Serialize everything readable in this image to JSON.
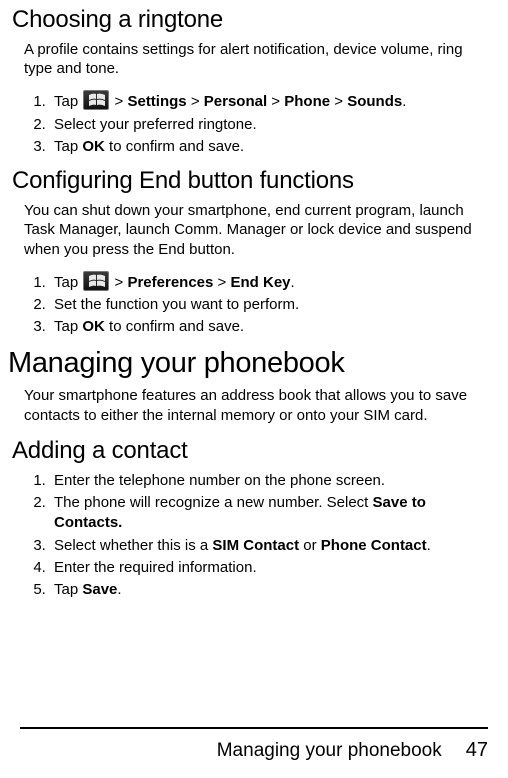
{
  "sections": {
    "ringtone": {
      "heading": "Choosing a ringtone",
      "intro": "A profile contains settings for alert notification, device volume, ring type and tone.",
      "steps": {
        "s1_pre": "Tap ",
        "s1_path1": "Settings",
        "s1_path2": "Personal",
        "s1_path3": "Phone",
        "s1_path4": "Sounds",
        "s2": "Select your preferred ringtone.",
        "s3_pre": "Tap ",
        "s3_ok": "OK",
        "s3_post": " to confirm and save."
      }
    },
    "endbtn": {
      "heading": "Configuring End button functions",
      "intro": "You can shut down your smartphone, end current program, launch Task Manager, launch Comm. Manager or lock device and suspend when you press the End button.",
      "steps": {
        "s1_pre": "Tap ",
        "s1_path1": "Preferences",
        "s1_path2": "End Key",
        "s2": "Set the function you want to perform.",
        "s3_pre": "Tap ",
        "s3_ok": "OK",
        "s3_post": " to confirm and save."
      }
    },
    "phonebook": {
      "heading": "Managing your phonebook",
      "intro": "Your smartphone features an address book that allows you to save contacts to either the internal memory or onto your SIM card."
    },
    "addcontact": {
      "heading": "Adding a contact",
      "steps": {
        "s1": "Enter the telephone number on the phone screen.",
        "s2_pre": "The phone will recognize a new number. Select ",
        "s2_bold": "Save to Contacts.",
        "s3_pre": "Select whether this is a ",
        "s3_b1": "SIM Contact",
        "s3_mid": " or ",
        "s3_b2": "Phone Contact",
        "s4": "Enter the required information.",
        "s5_pre": "Tap ",
        "s5_bold": "Save"
      }
    }
  },
  "footer": {
    "title": "Managing your phonebook",
    "page": "47"
  },
  "glyphs": {
    "gt": " > "
  }
}
